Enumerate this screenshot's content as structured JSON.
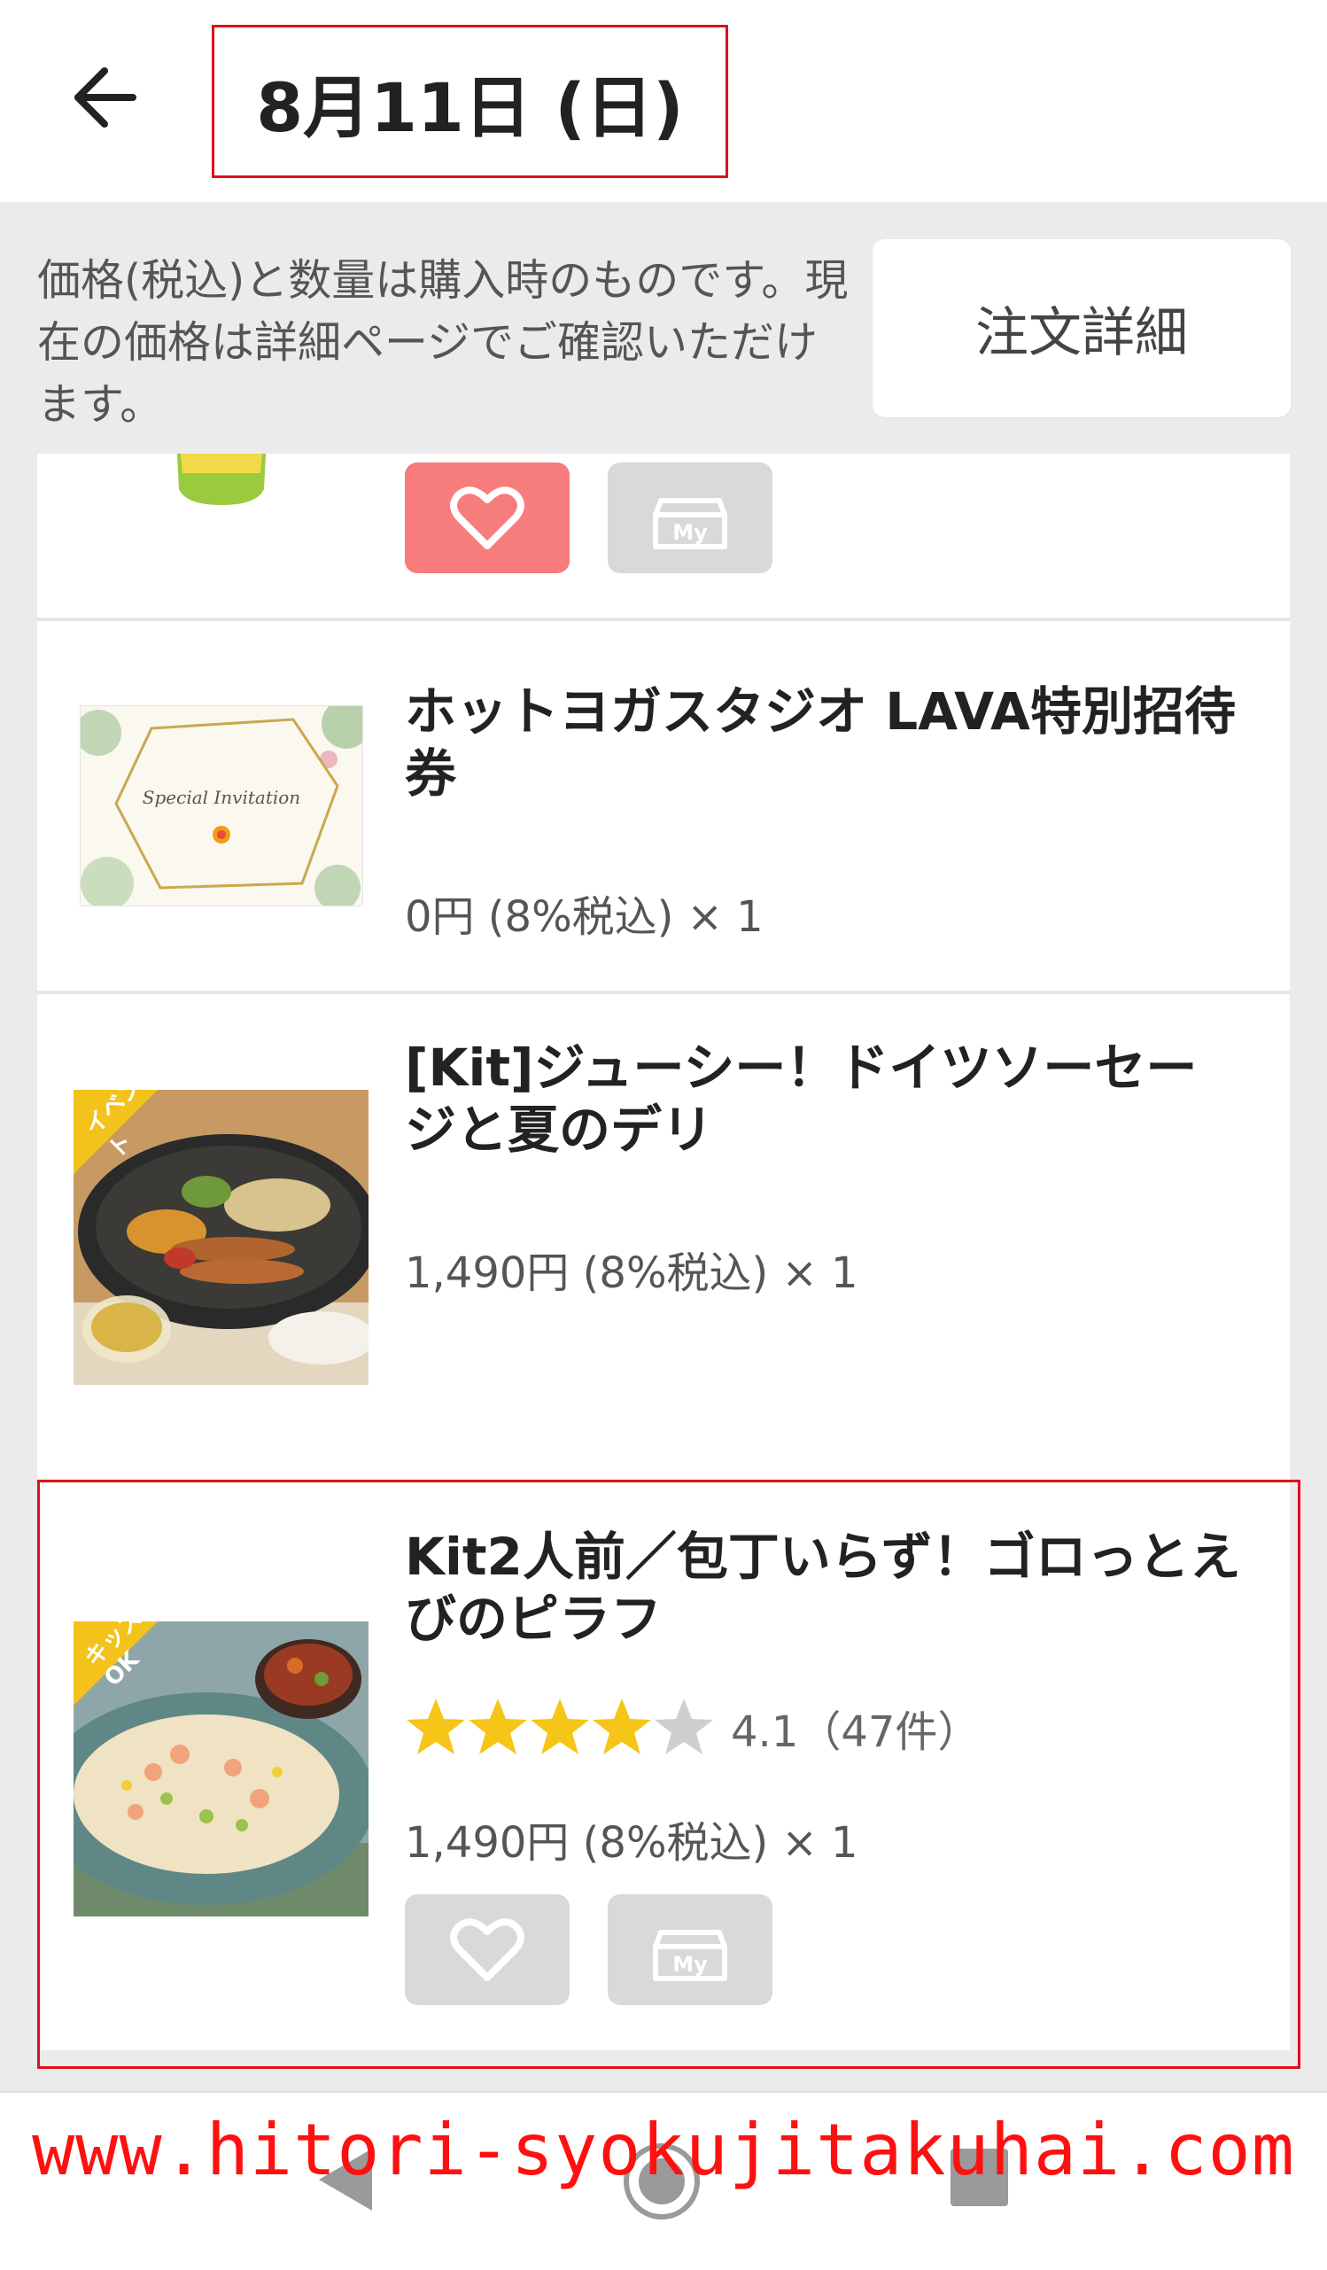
{
  "header": {
    "title": "8月11日 (日)",
    "back_icon": "arrow-left-icon"
  },
  "notice": {
    "text": "価格(税込)と数量は購入時のものです。現在の価格は詳細ページでご確認いただけます。",
    "detail_button": "注文詳細"
  },
  "items": [
    {
      "name": "ホットヨガスタジオ LAVA特別招待券",
      "price": "0円 (8%税込) × 1"
    },
    {
      "name": "[Kit]ジューシー！ドイツソーセージと夏のデリ",
      "price": "1,490円 (8%税込) × 1",
      "badge": "イベント"
    },
    {
      "name": "Kit2人前／包丁いらず！ゴロっとえびのピラフ",
      "price": "1,490円 (8%税込) × 1",
      "rating": 4.1,
      "rating_text": "4.1（47件）",
      "badge": "キッズOK"
    }
  ],
  "my_label": "My",
  "coupon_text": "Special Invitation",
  "watermark": "www.hitori-syokujitakuhai.com",
  "colors": {
    "accent_red": "#e0101a",
    "fav_active": "#f77c7c",
    "star": "#f5c518"
  }
}
